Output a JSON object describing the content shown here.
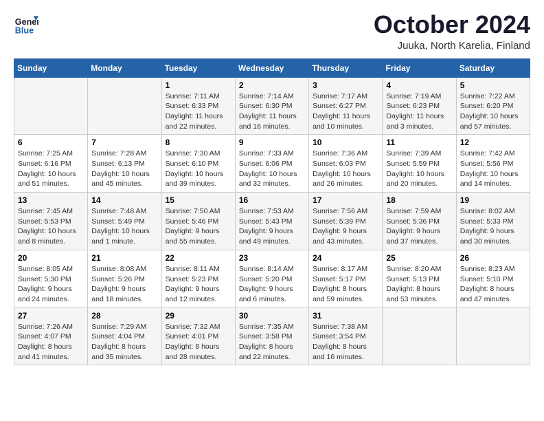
{
  "header": {
    "logo_line1": "General",
    "logo_line2": "Blue",
    "title": "October 2024",
    "subtitle": "Juuka, North Karelia, Finland"
  },
  "weekdays": [
    "Sunday",
    "Monday",
    "Tuesday",
    "Wednesday",
    "Thursday",
    "Friday",
    "Saturday"
  ],
  "weeks": [
    [
      {
        "day": "",
        "detail": ""
      },
      {
        "day": "",
        "detail": ""
      },
      {
        "day": "1",
        "detail": "Sunrise: 7:11 AM\nSunset: 6:33 PM\nDaylight: 11 hours\nand 22 minutes."
      },
      {
        "day": "2",
        "detail": "Sunrise: 7:14 AM\nSunset: 6:30 PM\nDaylight: 11 hours\nand 16 minutes."
      },
      {
        "day": "3",
        "detail": "Sunrise: 7:17 AM\nSunset: 6:27 PM\nDaylight: 11 hours\nand 10 minutes."
      },
      {
        "day": "4",
        "detail": "Sunrise: 7:19 AM\nSunset: 6:23 PM\nDaylight: 11 hours\nand 3 minutes."
      },
      {
        "day": "5",
        "detail": "Sunrise: 7:22 AM\nSunset: 6:20 PM\nDaylight: 10 hours\nand 57 minutes."
      }
    ],
    [
      {
        "day": "6",
        "detail": "Sunrise: 7:25 AM\nSunset: 6:16 PM\nDaylight: 10 hours\nand 51 minutes."
      },
      {
        "day": "7",
        "detail": "Sunrise: 7:28 AM\nSunset: 6:13 PM\nDaylight: 10 hours\nand 45 minutes."
      },
      {
        "day": "8",
        "detail": "Sunrise: 7:30 AM\nSunset: 6:10 PM\nDaylight: 10 hours\nand 39 minutes."
      },
      {
        "day": "9",
        "detail": "Sunrise: 7:33 AM\nSunset: 6:06 PM\nDaylight: 10 hours\nand 32 minutes."
      },
      {
        "day": "10",
        "detail": "Sunrise: 7:36 AM\nSunset: 6:03 PM\nDaylight: 10 hours\nand 26 minutes."
      },
      {
        "day": "11",
        "detail": "Sunrise: 7:39 AM\nSunset: 5:59 PM\nDaylight: 10 hours\nand 20 minutes."
      },
      {
        "day": "12",
        "detail": "Sunrise: 7:42 AM\nSunset: 5:56 PM\nDaylight: 10 hours\nand 14 minutes."
      }
    ],
    [
      {
        "day": "13",
        "detail": "Sunrise: 7:45 AM\nSunset: 5:53 PM\nDaylight: 10 hours\nand 8 minutes."
      },
      {
        "day": "14",
        "detail": "Sunrise: 7:48 AM\nSunset: 5:49 PM\nDaylight: 10 hours\nand 1 minute."
      },
      {
        "day": "15",
        "detail": "Sunrise: 7:50 AM\nSunset: 5:46 PM\nDaylight: 9 hours\nand 55 minutes."
      },
      {
        "day": "16",
        "detail": "Sunrise: 7:53 AM\nSunset: 5:43 PM\nDaylight: 9 hours\nand 49 minutes."
      },
      {
        "day": "17",
        "detail": "Sunrise: 7:56 AM\nSunset: 5:39 PM\nDaylight: 9 hours\nand 43 minutes."
      },
      {
        "day": "18",
        "detail": "Sunrise: 7:59 AM\nSunset: 5:36 PM\nDaylight: 9 hours\nand 37 minutes."
      },
      {
        "day": "19",
        "detail": "Sunrise: 8:02 AM\nSunset: 5:33 PM\nDaylight: 9 hours\nand 30 minutes."
      }
    ],
    [
      {
        "day": "20",
        "detail": "Sunrise: 8:05 AM\nSunset: 5:30 PM\nDaylight: 9 hours\nand 24 minutes."
      },
      {
        "day": "21",
        "detail": "Sunrise: 8:08 AM\nSunset: 5:26 PM\nDaylight: 9 hours\nand 18 minutes."
      },
      {
        "day": "22",
        "detail": "Sunrise: 8:11 AM\nSunset: 5:23 PM\nDaylight: 9 hours\nand 12 minutes."
      },
      {
        "day": "23",
        "detail": "Sunrise: 8:14 AM\nSunset: 5:20 PM\nDaylight: 9 hours\nand 6 minutes."
      },
      {
        "day": "24",
        "detail": "Sunrise: 8:17 AM\nSunset: 5:17 PM\nDaylight: 8 hours\nand 59 minutes."
      },
      {
        "day": "25",
        "detail": "Sunrise: 8:20 AM\nSunset: 5:13 PM\nDaylight: 8 hours\nand 53 minutes."
      },
      {
        "day": "26",
        "detail": "Sunrise: 8:23 AM\nSunset: 5:10 PM\nDaylight: 8 hours\nand 47 minutes."
      }
    ],
    [
      {
        "day": "27",
        "detail": "Sunrise: 7:26 AM\nSunset: 4:07 PM\nDaylight: 8 hours\nand 41 minutes."
      },
      {
        "day": "28",
        "detail": "Sunrise: 7:29 AM\nSunset: 4:04 PM\nDaylight: 8 hours\nand 35 minutes."
      },
      {
        "day": "29",
        "detail": "Sunrise: 7:32 AM\nSunset: 4:01 PM\nDaylight: 8 hours\nand 28 minutes."
      },
      {
        "day": "30",
        "detail": "Sunrise: 7:35 AM\nSunset: 3:58 PM\nDaylight: 8 hours\nand 22 minutes."
      },
      {
        "day": "31",
        "detail": "Sunrise: 7:38 AM\nSunset: 3:54 PM\nDaylight: 8 hours\nand 16 minutes."
      },
      {
        "day": "",
        "detail": ""
      },
      {
        "day": "",
        "detail": ""
      }
    ]
  ]
}
